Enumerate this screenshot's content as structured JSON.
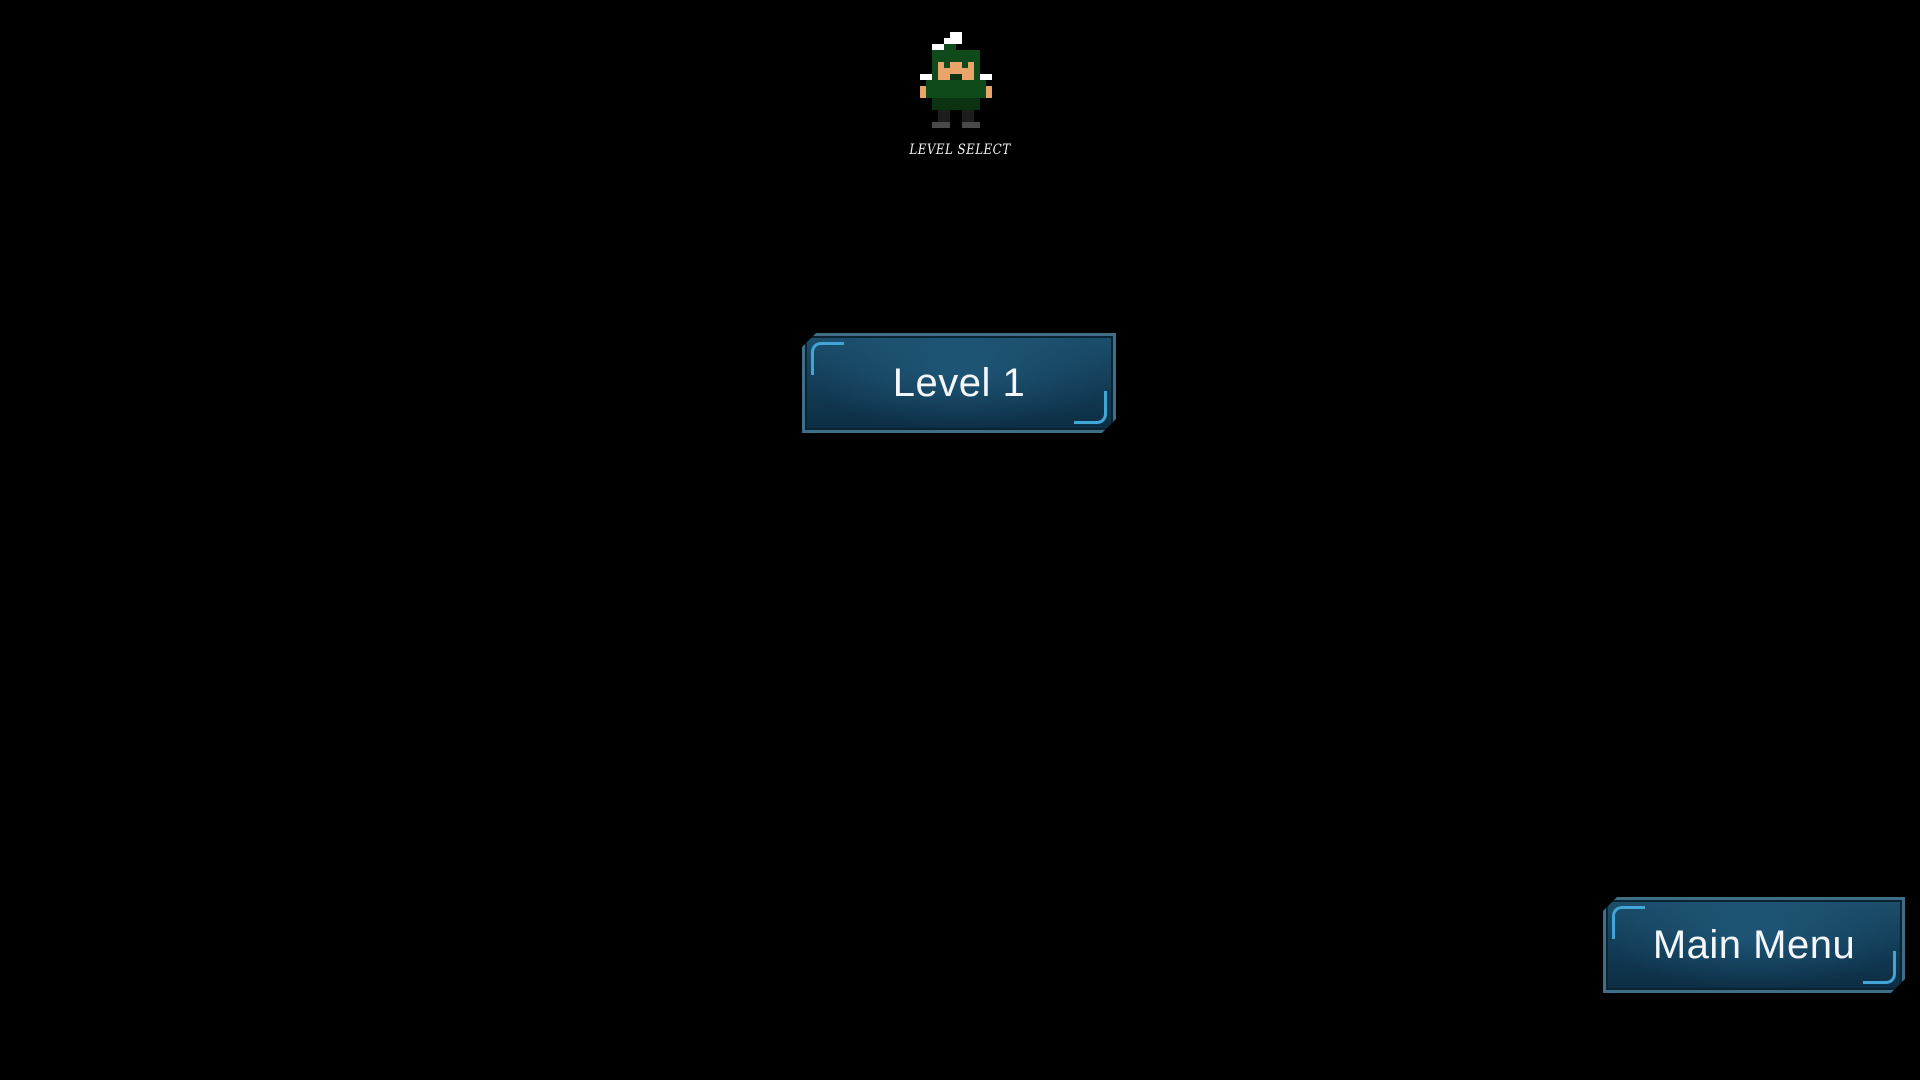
{
  "screen": {
    "title": "LEVEL SELECT"
  },
  "character": {
    "icon": "green-hooded-character-icon"
  },
  "levels": [
    {
      "label": "Level 1"
    }
  ],
  "navigation": {
    "main_menu_label": "Main Menu"
  },
  "colors": {
    "background": "#000000",
    "button_fill": "#123b55",
    "button_border": "#3f6e86",
    "button_accent": "#41a6d6",
    "button_text": "#f3f7fa"
  }
}
